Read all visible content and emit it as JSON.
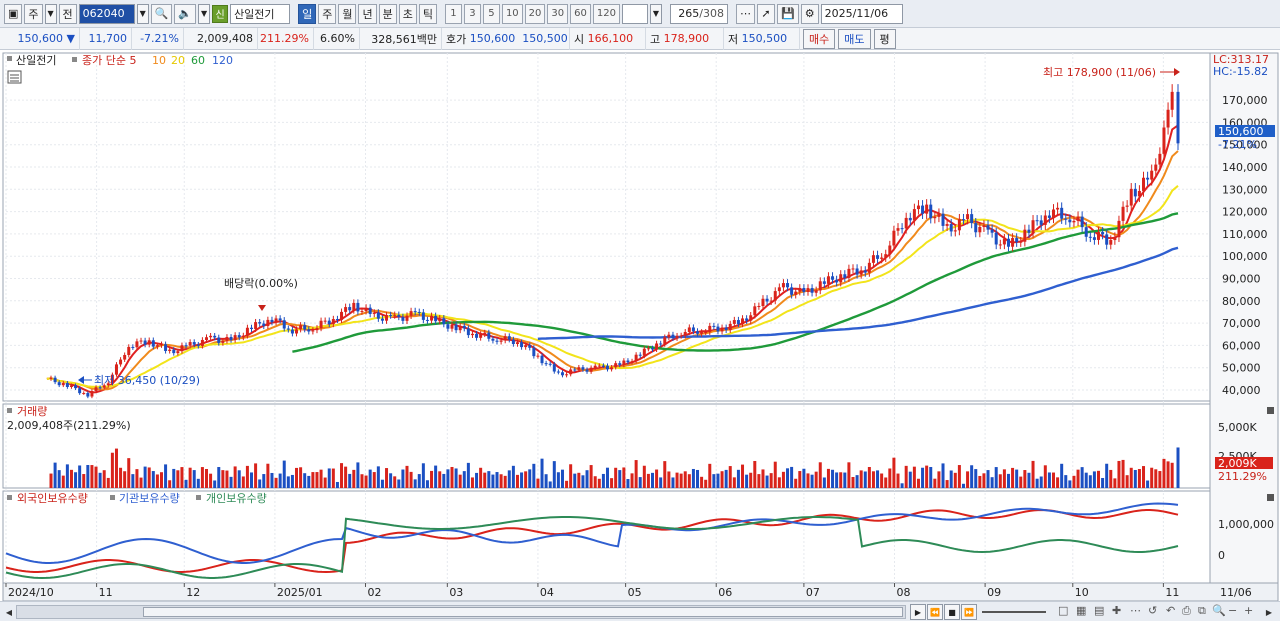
{
  "toolbar": {
    "type_label": "주",
    "prev_label": "전",
    "code": "062040",
    "badge": "신",
    "stock_name": "산일전기",
    "periods": [
      "일",
      "주",
      "월",
      "년",
      "분",
      "초",
      "틱"
    ],
    "active_period": "일",
    "intervals": [
      "1",
      "3",
      "5",
      "10",
      "20",
      "30",
      "60",
      "120"
    ],
    "count_value": "265",
    "count_total": "/308",
    "date": "2025/11/06"
  },
  "quote": {
    "price": "150,600",
    "change": "11,700",
    "change_pct": "-7.21%",
    "volume": "2,009,408",
    "volume_ratio": "211.29%",
    "turnover": "6.60%",
    "amount": "328,561백만",
    "bid_label": "호가",
    "bid": "150,600",
    "ask": "150,500",
    "open_label": "시",
    "open": "166,100",
    "high_label": "고",
    "high": "178,900",
    "low_label": "저",
    "low": "150,500",
    "buy_label": "매수",
    "sell_label": "매도",
    "eval_label": "평"
  },
  "price_panel": {
    "name": "산일전기",
    "legend_prefix": "종가 단순",
    "ma": [
      {
        "period": "5",
        "color": "#e02020"
      },
      {
        "period": "10",
        "color": "#f08a1c"
      },
      {
        "period": "20",
        "color": "#f2e41a"
      },
      {
        "period": "60",
        "color": "#1f9a3a"
      },
      {
        "period": "120",
        "color": "#2f5fd0"
      }
    ],
    "lc_label": "LC:313.17",
    "hc_label": "HC:-15.82",
    "current_price": "150,600",
    "current_pct": "-7.21%",
    "high_note": "최고 178,900 (11/06)",
    "low_note": "최저 36,450 (10/29)",
    "dividend_note": "배당락(0.00%)",
    "y_ticks": [
      "40,000",
      "50,000",
      "60,000",
      "70,000",
      "80,000",
      "90,000",
      "100,000",
      "110,000",
      "120,000",
      "130,000",
      "140,000",
      "150,000",
      "160,000",
      "170,000"
    ]
  },
  "volume_panel": {
    "title": "거래량",
    "value": "2,009,408주(211.29%)",
    "tick": "5,000K",
    "tick2": "2,500K",
    "current": "2,009K",
    "current_pct": "211.29%"
  },
  "holdings_panel": {
    "foreign": "외국인보유수량",
    "institution": "기관보유수량",
    "individual": "개인보유수량",
    "tick_1m": "1,000,000",
    "tick_0": "0"
  },
  "x_axis": {
    "labels": [
      "2024/10",
      "11",
      "12",
      "2025/01",
      "02",
      "03",
      "04",
      "05",
      "06",
      "07",
      "08",
      "09",
      "10",
      "11"
    ],
    "end_label": "11/06"
  },
  "colors": {
    "up": "#d9231b",
    "down": "#1b4fc2",
    "foreign": "#d9231b",
    "institution": "#2f5fd0",
    "individual": "#2e8b57"
  },
  "chart_data": {
    "type": "candlestick",
    "title": "",
    "xlabel": "",
    "ylabel": "",
    "ylim": [
      30000,
      180000
    ],
    "close_points": [
      [
        "2024-10-15",
        45000
      ],
      [
        "2024-10-22",
        42000
      ],
      [
        "2024-10-29",
        38000
      ],
      [
        "2024-11-05",
        44000
      ],
      [
        "2024-11-12",
        60000
      ],
      [
        "2024-11-19",
        62000
      ],
      [
        "2024-11-26",
        57000
      ],
      [
        "2024-12-03",
        60000
      ],
      [
        "2024-12-10",
        63000
      ],
      [
        "2024-12-17",
        62000
      ],
      [
        "2024-12-24",
        68000
      ],
      [
        "2024-12-31",
        72000
      ],
      [
        "2025-01-07",
        67000
      ],
      [
        "2025-01-14",
        68000
      ],
      [
        "2025-01-21",
        72000
      ],
      [
        "2025-01-28",
        78000
      ],
      [
        "2025-02-04",
        73000
      ],
      [
        "2025-02-11",
        72000
      ],
      [
        "2025-02-18",
        74000
      ],
      [
        "2025-02-25",
        71000
      ],
      [
        "2025-03-04",
        68000
      ],
      [
        "2025-03-11",
        65000
      ],
      [
        "2025-03-18",
        63000
      ],
      [
        "2025-03-25",
        62000
      ],
      [
        "2025-04-01",
        55000
      ],
      [
        "2025-04-08",
        47000
      ],
      [
        "2025-04-15",
        49000
      ],
      [
        "2025-04-22",
        50000
      ],
      [
        "2025-04-29",
        51000
      ],
      [
        "2025-05-06",
        56000
      ],
      [
        "2025-05-13",
        62000
      ],
      [
        "2025-05-20",
        66000
      ],
      [
        "2025-05-27",
        67000
      ],
      [
        "2025-06-03",
        68000
      ],
      [
        "2025-06-10",
        71000
      ],
      [
        "2025-06-17",
        79000
      ],
      [
        "2025-06-24",
        86000
      ],
      [
        "2025-07-01",
        83000
      ],
      [
        "2025-07-08",
        88000
      ],
      [
        "2025-07-15",
        92000
      ],
      [
        "2025-07-22",
        95000
      ],
      [
        "2025-07-29",
        103000
      ],
      [
        "2025-08-05",
        118000
      ],
      [
        "2025-08-12",
        122000
      ],
      [
        "2025-08-19",
        112000
      ],
      [
        "2025-08-26",
        116000
      ],
      [
        "2025-09-02",
        110000
      ],
      [
        "2025-09-09",
        104000
      ],
      [
        "2025-09-16",
        112000
      ],
      [
        "2025-09-23",
        120000
      ],
      [
        "2025-09-30",
        118000
      ],
      [
        "2025-10-07",
        110000
      ],
      [
        "2025-10-14",
        107000
      ],
      [
        "2025-10-21",
        128000
      ],
      [
        "2025-10-28",
        135000
      ],
      [
        "2025-11-04",
        170000
      ],
      [
        "2025-11-06",
        150600
      ]
    ]
  }
}
